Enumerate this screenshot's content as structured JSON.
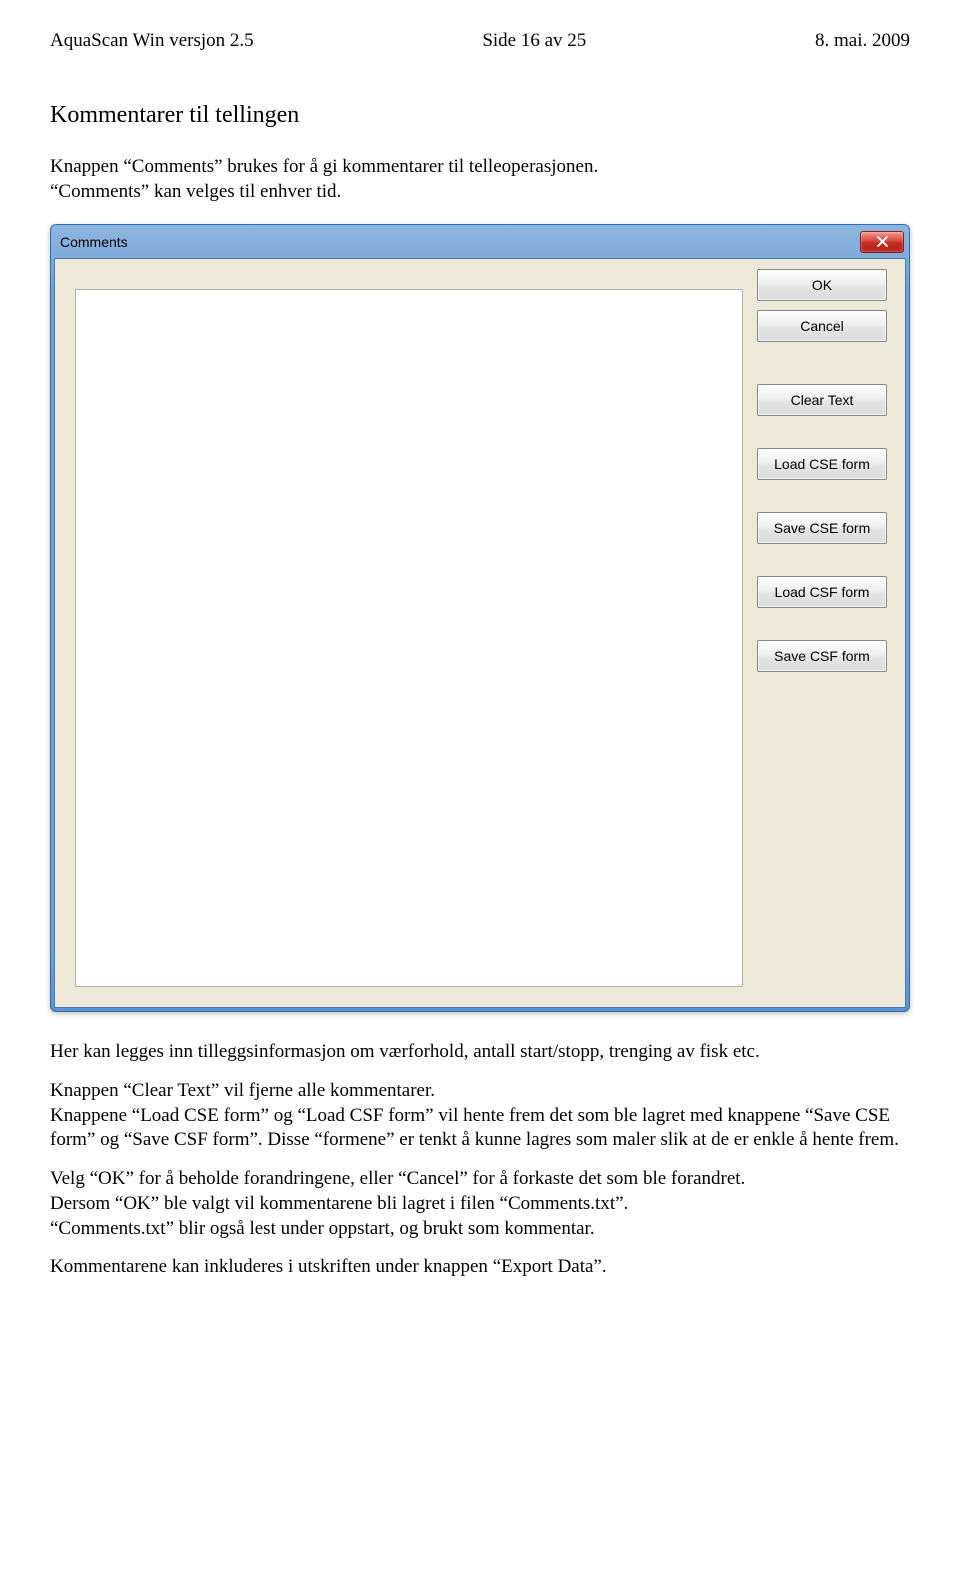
{
  "header": {
    "left": "AquaScan Win versjon 2.5",
    "center": "Side 16 av 25",
    "right": "8. mai. 2009"
  },
  "doc": {
    "title": "Kommentarer til tellingen",
    "p1": "Knappen “Comments” brukes for å gi kommentarer til telleoperasjonen.",
    "p2": "“Comments” kan velges til enhver tid.",
    "p3": "Her kan legges inn tilleggsinformasjon om værforhold, antall start/stopp, trenging av fisk etc.",
    "p4a": "Knappen “Clear Text” vil fjerne alle kommentarer.",
    "p4b": "Knappene “Load CSE form” og “Load CSF form” vil hente frem det som ble lagret med knappene “Save CSE form” og “Save CSF form”. Disse “formene” er tenkt å kunne lagres som maler slik at de er enkle å hente frem.",
    "p5a": "Velg “OK” for å beholde forandringene, eller “Cancel” for å forkaste det som ble forandret.",
    "p5b": "Dersom “OK” ble valgt vil kommentarene bli lagret i filen “Comments.txt”.",
    "p5c": "“Comments.txt” blir også lest under oppstart, og brukt som kommentar.",
    "p6": "Kommentarene kan inkluderes i utskriften under knappen “Export Data”."
  },
  "window": {
    "title": "Comments",
    "textarea_value": "",
    "buttons": {
      "ok": "OK",
      "cancel": "Cancel",
      "clear": "Clear Text",
      "load_cse": "Load CSE form",
      "save_cse": "Save CSE form",
      "load_csf": "Load CSF form",
      "save_csf": "Save CSF form"
    }
  }
}
